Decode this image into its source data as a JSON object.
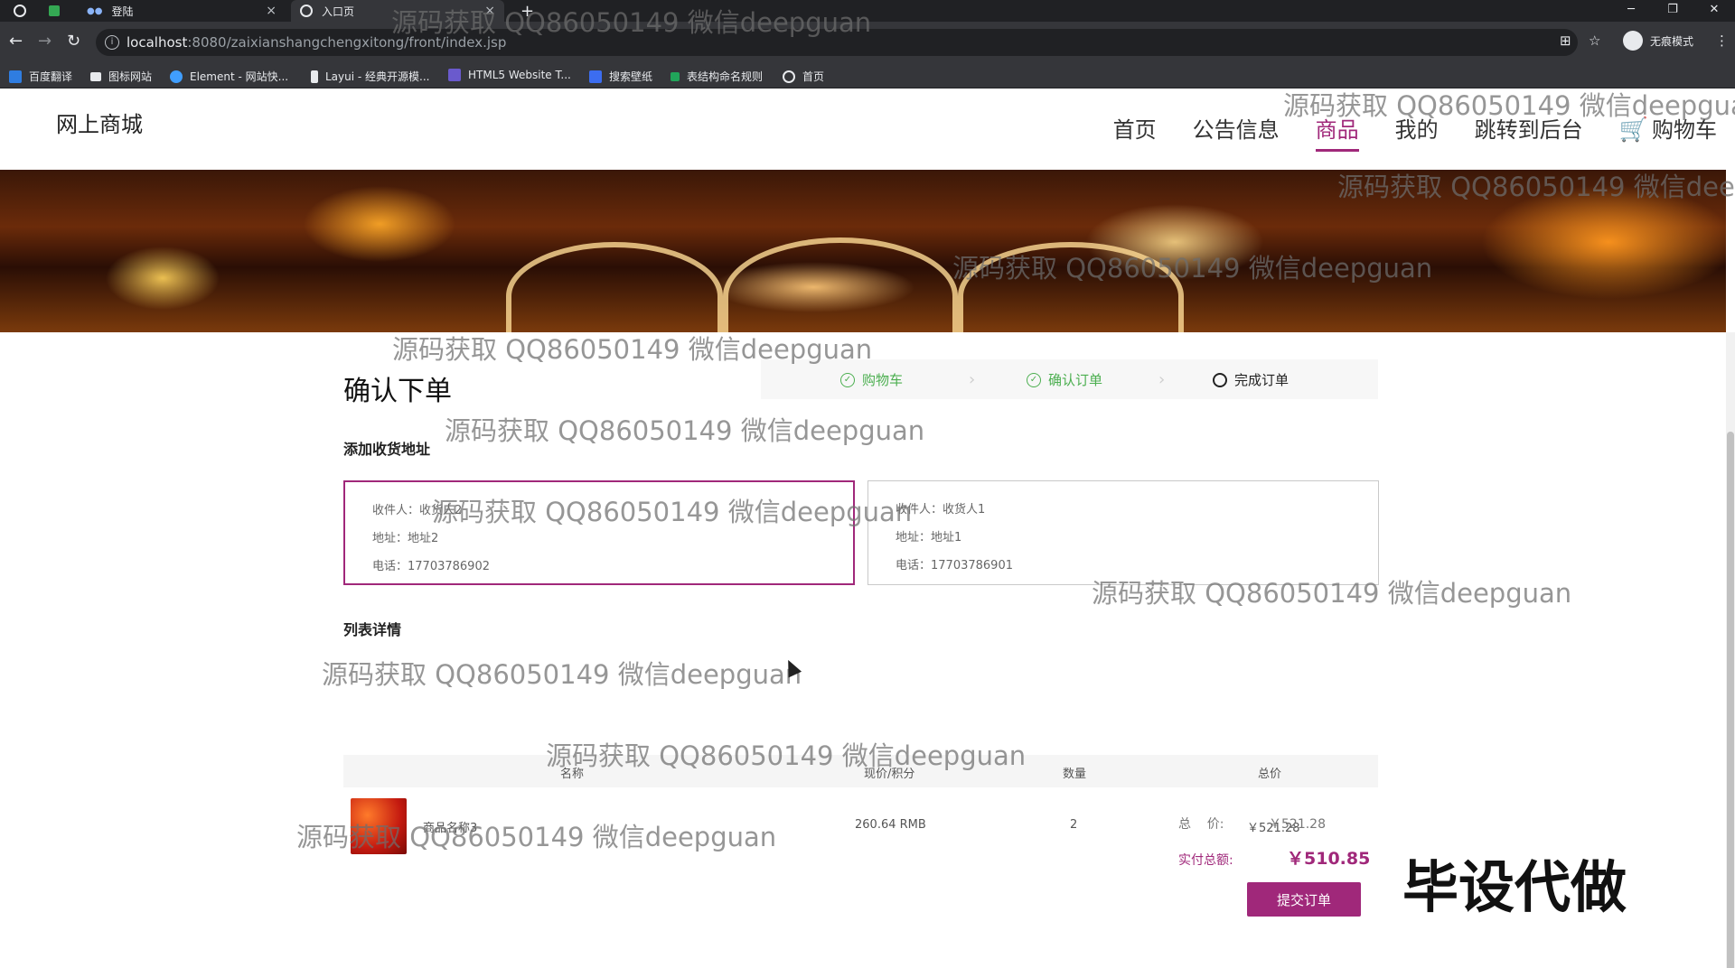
{
  "browser": {
    "tabs": [
      {
        "title": "登陆"
      },
      {
        "title": "入口页"
      }
    ],
    "url_host": "localhost",
    "url_rest": ":8080/zaixianshangchengxitong/front/index.jsp",
    "incognito_label": "无痕模式",
    "bookmarks": [
      "百度翻译",
      "图标网站",
      "Element - 网站快...",
      "Layui - 经典开源模...",
      "HTML5 Website T...",
      "搜索壁纸",
      "表结构命名规则",
      "首页"
    ]
  },
  "site": {
    "logo": "网上商城",
    "nav": [
      "首页",
      "公告信息",
      "商品",
      "我的",
      "跳转到后台",
      "购物车"
    ],
    "active_nav": "商品",
    "accent_color": "#a0287a"
  },
  "order": {
    "title": "确认下单",
    "steps": [
      {
        "label": "购物车",
        "state": "done"
      },
      {
        "label": "确认订单",
        "state": "done"
      },
      {
        "label": "完成订单",
        "state": "todo"
      }
    ],
    "address_section": "添加收货地址",
    "addresses": [
      {
        "receiver_label": "收件人：",
        "receiver": "收货人2",
        "addr_label": "地址：",
        "addr": "地址2",
        "phone_label": "电话：",
        "phone": "17703786902",
        "selected": true
      },
      {
        "receiver_label": "收件人：",
        "receiver": "收货人1",
        "addr_label": "地址：",
        "addr": "地址1",
        "phone_label": "电话：",
        "phone": "17703786901",
        "selected": false
      }
    ],
    "list_section": "列表详情",
    "columns": [
      "名称",
      "现价/积分",
      "数量",
      "总价"
    ],
    "items": [
      {
        "name": "商品名称3",
        "price": "260.64 RMB",
        "qty": "2",
        "total": "￥521.28"
      }
    ],
    "total_label": "总    价:",
    "total_value": "￥521.28",
    "pay_label": "实付总额:",
    "pay_value": "￥510.85",
    "submit": "提交订单"
  },
  "overlay": {
    "watermark": "源码获取 QQ86050149 微信deepguan",
    "promo": "毕设代做"
  }
}
